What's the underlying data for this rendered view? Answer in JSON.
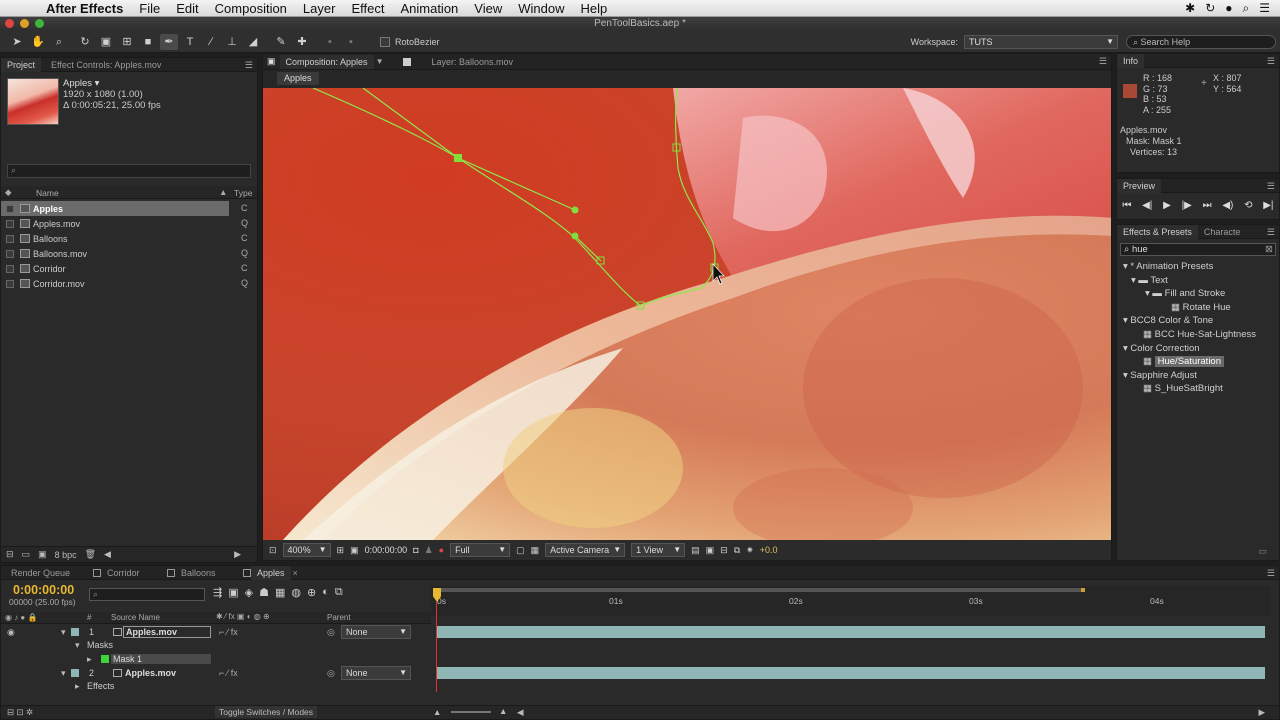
{
  "menubar": {
    "app_name": "After Effects",
    "items": [
      "File",
      "Edit",
      "Composition",
      "Layer",
      "Effect",
      "Animation",
      "View",
      "Window",
      "Help"
    ]
  },
  "window": {
    "title": "PenToolBasics.aep *"
  },
  "toolbar": {
    "rotobezier_label": "RotoBezier",
    "workspace_label": "Workspace:",
    "workspace_value": "TUTS",
    "search_help_placeholder": "Search Help"
  },
  "project": {
    "tabs": [
      "Project",
      "Effect Controls: Apples.mov"
    ],
    "selected_name": "Apples ▾",
    "selected_dims": "1920 x 1080 (1.00)",
    "selected_duration": "Δ 0:00:05:21, 25.00 fps",
    "col_name": "Name",
    "col_type": "Type",
    "items": [
      {
        "name": "Apples",
        "type": "C"
      },
      {
        "name": "Apples.mov",
        "type": "Q"
      },
      {
        "name": "Balloons",
        "type": "C"
      },
      {
        "name": "Balloons.mov",
        "type": "Q"
      },
      {
        "name": "Corridor",
        "type": "C"
      },
      {
        "name": "Corridor.mov",
        "type": "Q"
      }
    ],
    "bpc": "8 bpc"
  },
  "composition": {
    "tab_comp": "Composition: Apples",
    "tab_layer": "Layer: Balloons.mov",
    "breadcrumb": "Apples",
    "zoom": "400%",
    "timecode": "0:00:00:00",
    "resolution": "Full",
    "camera": "Active Camera",
    "views": "1 View",
    "exposure": "+0.0"
  },
  "info": {
    "tab": "Info",
    "r": "R : 168",
    "g": "G : 73",
    "b": "B : 53",
    "a": "A : 255",
    "x": "X : 807",
    "y": "Y : 564",
    "layer": "Apples.mov",
    "mask": "Mask: Mask 1",
    "vertices": "Vertices: 13",
    "swatch_color": "#a84935"
  },
  "preview": {
    "tab": "Preview"
  },
  "effects": {
    "tabs": [
      "Effects & Presets",
      "Characte"
    ],
    "search_value": "hue",
    "tree": [
      {
        "label": "* Animation Presets",
        "indent": 0,
        "kind": "folder"
      },
      {
        "label": "Text",
        "indent": 1,
        "kind": "folder"
      },
      {
        "label": "Fill and Stroke",
        "indent": 2,
        "kind": "folder"
      },
      {
        "label": "Rotate Hue",
        "indent": 3,
        "kind": "preset"
      },
      {
        "label": "BCC8 Color & Tone",
        "indent": 0,
        "kind": "cat"
      },
      {
        "label": "BCC Hue-Sat-Lightness",
        "indent": 1,
        "kind": "effect"
      },
      {
        "label": "Color Correction",
        "indent": 0,
        "kind": "cat"
      },
      {
        "label": "Hue/Saturation",
        "indent": 1,
        "kind": "effect",
        "selected": true
      },
      {
        "label": "Sapphire Adjust",
        "indent": 0,
        "kind": "cat"
      },
      {
        "label": "S_HueSatBright",
        "indent": 1,
        "kind": "effect"
      }
    ]
  },
  "timeline": {
    "tabs": [
      "Render Queue",
      "Corridor",
      "Balloons",
      "Apples"
    ],
    "timecode": "0:00:00:00",
    "frame_info": "00000 (25.00 fps)",
    "col_source": "Source Name",
    "col_parent": "Parent",
    "ruler": [
      "0s",
      "01s",
      "02s",
      "03s",
      "04s"
    ],
    "layers": [
      {
        "num": "1",
        "name": "Apples.mov",
        "parent": "None"
      },
      {
        "num": "2",
        "name": "Apples.mov",
        "parent": "None"
      }
    ],
    "masks_label": "Masks",
    "mask_name": "Mask 1",
    "effects_label": "Effects",
    "toggle_label": "Toggle Switches / Modes"
  }
}
